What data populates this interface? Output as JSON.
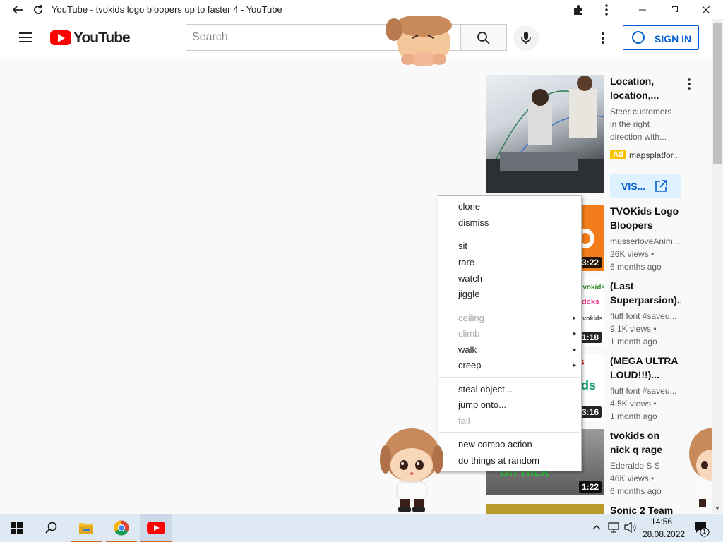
{
  "window": {
    "title": "YouTube - tvokids logo bloopers up to faster 4 - YouTube"
  },
  "masthead": {
    "logo_text": "YouTube",
    "search_placeholder": "Search",
    "signin_label": "SIGN IN"
  },
  "sidebar": {
    "ad": {
      "title": "Location, location,...",
      "desc_lines": [
        "Steer customers",
        "in the right",
        "direction with..."
      ],
      "badge": "Ad",
      "advertiser": "mapsplatfor...",
      "visit_label": "VIS..."
    },
    "videos": [
      {
        "title": "TVOKids Logo Bloopers Thre...",
        "channel": "musserloveAnim...",
        "views": "26K views •",
        "age": "6 months ago",
        "duration": "3:22"
      },
      {
        "title": "(Last Superparsion)...",
        "channel": "fluff font #saveu...",
        "views": "9.1K views •",
        "age": "1 month ago",
        "duration": "1:18"
      },
      {
        "title": "(MEGA ULTRA LOUD!!!)...",
        "channel": "fluff font #saveu...",
        "views": "4.5K views •",
        "age": "1 month ago",
        "duration": "3:16"
      },
      {
        "title": "tvokids on nick q rage",
        "channel": "Ederaldo S S",
        "views": "46K views •",
        "age": "6 months ago",
        "duration": "1:22"
      },
      {
        "title": "Sonic 2 Team"
      }
    ]
  },
  "context_menu": {
    "groups": [
      [
        {
          "label": "clone"
        },
        {
          "label": "dismiss"
        }
      ],
      [
        {
          "label": "sit"
        },
        {
          "label": "rare"
        },
        {
          "label": "watch"
        },
        {
          "label": "jiggle"
        }
      ],
      [
        {
          "label": "ceiling",
          "disabled": true,
          "submenu": true
        },
        {
          "label": "climb",
          "disabled": true,
          "submenu": true
        },
        {
          "label": "walk",
          "submenu": true
        },
        {
          "label": "creep",
          "submenu": true
        }
      ],
      [
        {
          "label": "steal object..."
        },
        {
          "label": "jump onto..."
        },
        {
          "label": "fall",
          "disabled": true
        }
      ],
      [
        {
          "label": "new combo action"
        },
        {
          "label": "do things at random"
        }
      ]
    ]
  },
  "taskbar": {
    "time": "14:56",
    "date": "28.08.2022",
    "notification_count": "1"
  },
  "colors": {
    "youtube_red": "#ff0000",
    "signin_blue": "#065fd4",
    "ad_yellow": "#f9c200",
    "taskbar_bg": "#dfe9f3"
  }
}
